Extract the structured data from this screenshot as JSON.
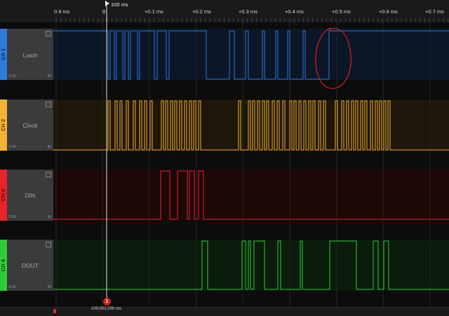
{
  "timeline": {
    "marker_label": "100 ms",
    "ticks": [
      "0.9 ms",
      "0",
      "+0.1 ms",
      "+0.2 ms",
      "+0.3 ms",
      "+0.4 ms",
      "+0.5 ms",
      "+0.6 ms",
      "+0.7 ms"
    ]
  },
  "cursor": {
    "badge": "1",
    "time_readout": "100,002,000 ms"
  },
  "channels": [
    {
      "id": "CH 1",
      "name": "Latch",
      "voltage": "3.3V",
      "input": "IN",
      "color": "#2e7be0",
      "bg": "#0b1626"
    },
    {
      "id": "CH 2",
      "name": "Clock",
      "voltage": "3.3V",
      "input": "IN",
      "color": "#f5b334",
      "bg": "#1e1608"
    },
    {
      "id": "CH 3",
      "name": "DIN",
      "voltage": "3.3V",
      "input": "IN",
      "color": "#e8242b",
      "bg": "#1e0707"
    },
    {
      "id": "CH 4",
      "name": "DOUT",
      "voltage": "3.3V",
      "input": "IN",
      "color": "#2fcc3a",
      "bg": "#0a1c0b"
    }
  ],
  "annotation_color": "#d42020"
}
